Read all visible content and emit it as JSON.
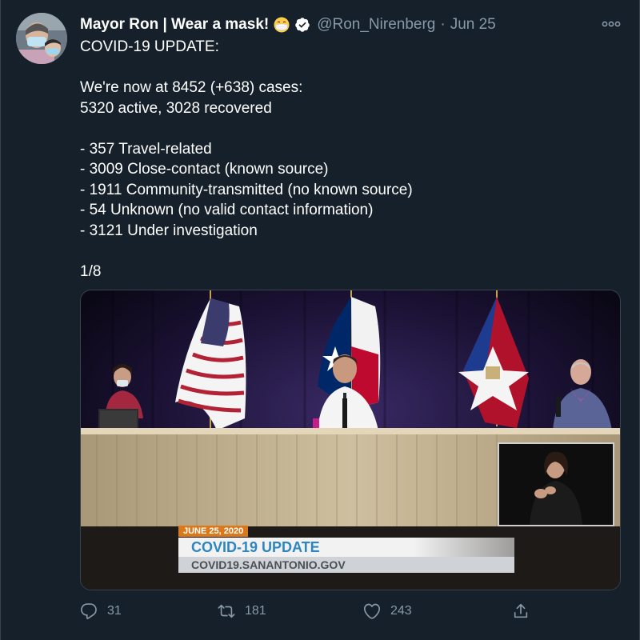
{
  "tweet": {
    "display_name": "Mayor Ron | Wear a mask!",
    "handle": "@Ron_Nirenberg",
    "separator": "·",
    "date": "Jun 25",
    "lines": [
      "COVID-19 UPDATE:",
      "",
      "We're now at 8452 (+638) cases:",
      "5320 active, 3028 recovered",
      "",
      "- 357 Travel-related",
      "- 3009 Close-contact (known source)",
      "- 1911 Community-transmitted (no known source)",
      "- 54 Unknown (no valid contact information)",
      "- 3121 Under investigation",
      "",
      "1/8"
    ]
  },
  "media": {
    "lower_third_date": "JUNE 25, 2020",
    "lower_third_title": "COVID-19 UPDATE",
    "lower_third_url": "COVID19.SANANTONIO.GOV"
  },
  "actions": {
    "reply_count": "31",
    "retweet_count": "181",
    "like_count": "243"
  },
  "icons": {
    "emoji": "face-with-medical-mask-icon",
    "verified": "verified-badge-icon",
    "more": "more-options-icon",
    "reply": "reply-icon",
    "retweet": "retweet-icon",
    "like": "heart-icon",
    "share": "share-icon"
  },
  "colors": {
    "background": "#15202b",
    "secondary_text": "#8899a6",
    "accent": "#1da1f2"
  }
}
